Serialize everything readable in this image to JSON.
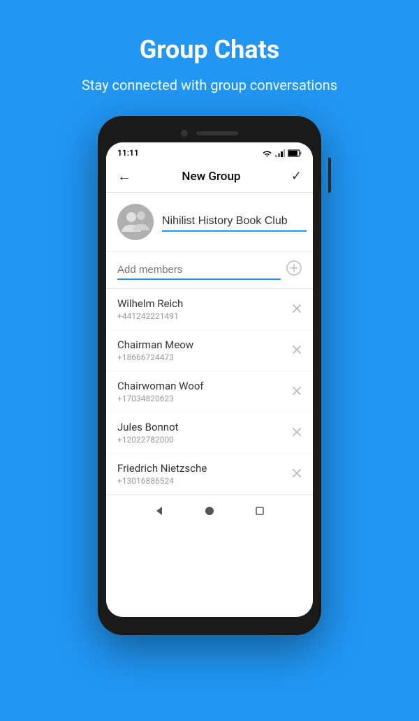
{
  "header": {
    "title": "Group Chats",
    "subtitle": "Stay connected with group conversations"
  },
  "phone": {
    "status_bar": {
      "time": "11:11"
    },
    "app_bar": {
      "title": "New Group",
      "back_label": "←",
      "confirm_label": "✓"
    },
    "group": {
      "name_placeholder": "Nihilist History Book Club",
      "add_members_placeholder": "Add members"
    },
    "members": [
      {
        "name": "Wilhelm Reich",
        "phone": "+441242221491"
      },
      {
        "name": "Chairman Meow",
        "phone": "+18666724473"
      },
      {
        "name": "Chairwoman Woof",
        "phone": "+17034820623"
      },
      {
        "name": "Jules Bonnot",
        "phone": "+12022782000"
      },
      {
        "name": "Friedrich Nietzsche",
        "phone": "+13016886524"
      }
    ]
  },
  "colors": {
    "primary": "#2196F3",
    "text_dark": "#333333",
    "text_light": "#999999",
    "divider": "#f0f0f0"
  }
}
